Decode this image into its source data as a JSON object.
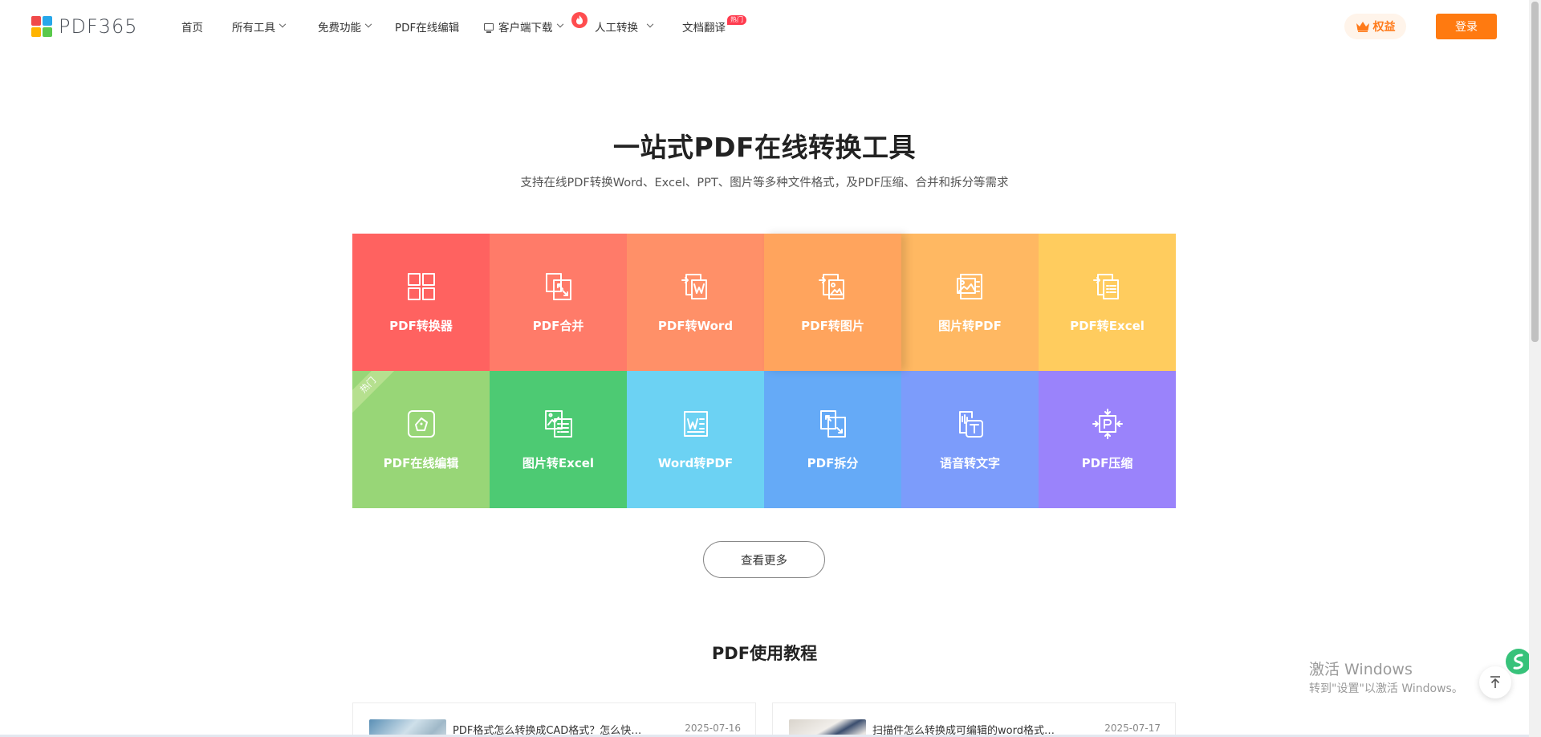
{
  "header": {
    "logo_text": "PDF365",
    "logo_colors": [
      "#f04a4a",
      "#27a7ea",
      "#ffb400",
      "#5ac94b"
    ],
    "nav": [
      {
        "label": "首页",
        "dropdown": false
      },
      {
        "label": "所有工具",
        "dropdown": true
      },
      {
        "label": "免费功能",
        "dropdown": true
      },
      {
        "label": "PDF在线编辑",
        "dropdown": false
      },
      {
        "label": "客户端下载",
        "dropdown": true,
        "icon": "monitor-icon"
      },
      {
        "label": "人工转换",
        "dropdown": true,
        "icon": "fire-icon"
      },
      {
        "label": "文档翻译",
        "dropdown": false,
        "badge": "热门"
      }
    ],
    "vip_label": "权益",
    "login_label": "登录",
    "accent": "#ff7a10"
  },
  "hero": {
    "title": "一站式PDF在线转换工具",
    "subtitle": "支持在线PDF转换Word、Excel、PPT、图片等多种文件格式，及PDF压缩、合并和拆分等需求"
  },
  "tools": [
    {
      "label": "PDF转换器",
      "icon": "grid-icon",
      "color": "#ff6260"
    },
    {
      "label": "PDF合并",
      "icon": "merge-icon",
      "color": "#ff7b69"
    },
    {
      "label": "PDF转Word",
      "icon": "pdf-to-word-icon",
      "color": "#ff9068"
    },
    {
      "label": "PDF转图片",
      "icon": "pdf-to-image-icon",
      "color": "#ffa45d"
    },
    {
      "label": "图片转PDF",
      "icon": "image-to-pdf-icon",
      "color": "#ffb862"
    },
    {
      "label": "PDF转Excel",
      "icon": "pdf-to-excel-icon",
      "color": "#ffcc5e"
    },
    {
      "label": "PDF在线编辑",
      "icon": "edit-icon",
      "color": "#98d677",
      "ribbon": "热门"
    },
    {
      "label": "图片转Excel",
      "icon": "image-to-excel-icon",
      "color": "#4dca73"
    },
    {
      "label": "Word转PDF",
      "icon": "word-to-pdf-icon",
      "color": "#6cd2f3"
    },
    {
      "label": "PDF拆分",
      "icon": "split-icon",
      "color": "#65aaf7"
    },
    {
      "label": "语音转文字",
      "icon": "speech-to-text-icon",
      "color": "#7c9cfb"
    },
    {
      "label": "PDF压缩",
      "icon": "compress-icon",
      "color": "#9a83fb"
    }
  ],
  "more_label": "查看更多",
  "tutorials": {
    "title": "PDF使用教程",
    "items": [
      {
        "title": "PDF格式怎么转换成CAD格式？怎么快…",
        "date": "2025-07-16"
      },
      {
        "title": "扫描件怎么转换成可编辑的word格式…",
        "date": "2025-07-17"
      }
    ]
  },
  "watermark": {
    "line1": "激活 Windows",
    "line2": "转到\"设置\"以激活 Windows。"
  }
}
